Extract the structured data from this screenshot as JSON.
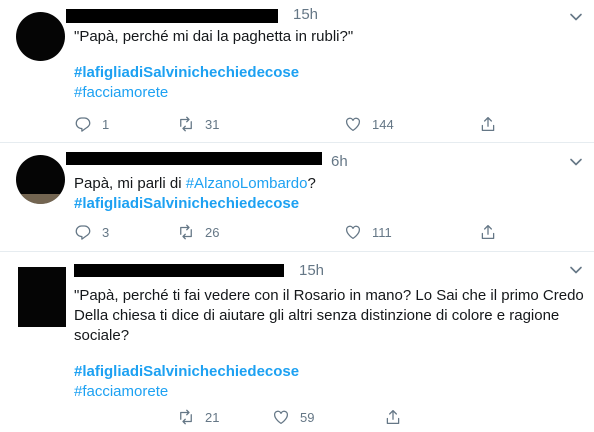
{
  "tweets": [
    {
      "time": "15h",
      "line1": "\"Papà, perché mi dai la paghetta in rubli?\"",
      "hashtag1": "#lafigliadiSalvinichechiedecose",
      "hashtag2": "#facciamorete",
      "replies": "1",
      "retweets": "31",
      "likes": "144"
    },
    {
      "time": "6h",
      "text_prefix": "Papà, mi parli di ",
      "mention": "#AlzanoLombardo",
      "text_suffix": "?",
      "hashtag1": "#lafigliadiSalvinichechiedecose",
      "replies": "3",
      "retweets": "26",
      "likes": "111"
    },
    {
      "time": "15h",
      "line1": "\"Papà, perché ti fai vedere con il Rosario in mano? Lo Sai che il primo  Credo",
      "line2": "Della chiesa ti dice di aiutare gli altri senza distinzione di colore e ragione",
      "line3": "sociale?",
      "hashtag1": "#lafigliadiSalvinichechiedecose",
      "hashtag2": "#facciamorete",
      "retweets": "21",
      "likes": "59"
    }
  ],
  "icons": {
    "reply": "reply-icon",
    "retweet": "retweet-icon",
    "like": "heart-icon",
    "share": "share-icon",
    "more": "chevron-down-icon"
  },
  "colors": {
    "link": "#1da1f2",
    "secondary": "#657786",
    "divider": "#e6ecf0"
  }
}
